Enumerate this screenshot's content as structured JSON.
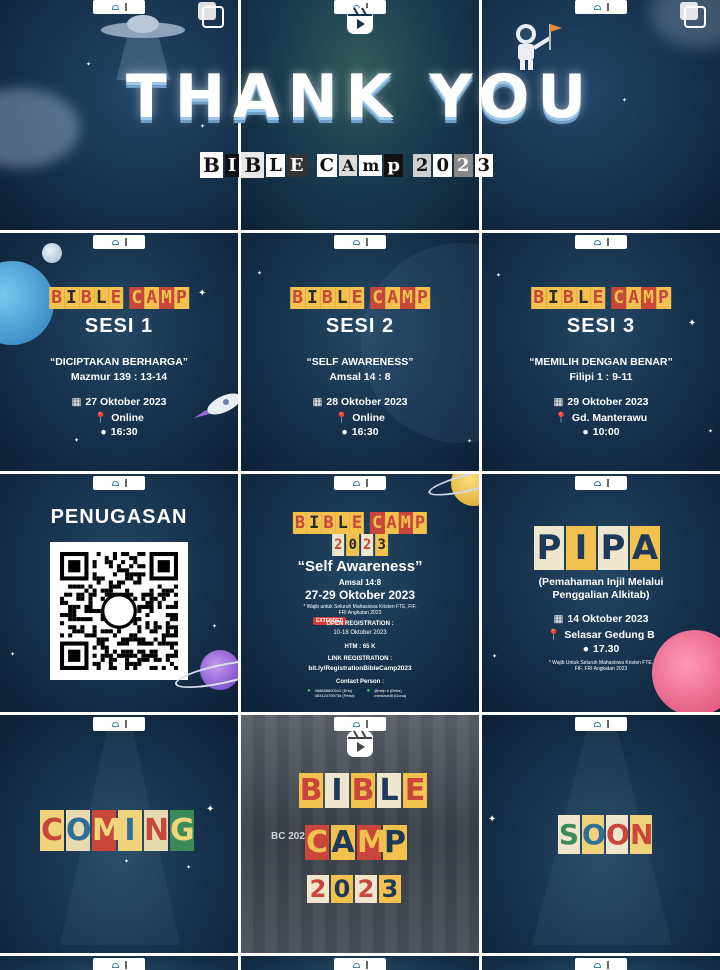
{
  "tile1": {
    "thank": "THANK YOU",
    "letters": [
      "B",
      "I",
      "B",
      "L",
      "E",
      " ",
      "C",
      "A",
      "m",
      "p",
      " ",
      "2",
      "0",
      "2",
      "3"
    ]
  },
  "sesi1": {
    "camp_a": [
      "B",
      "I",
      "B",
      "L",
      "E"
    ],
    "camp_b": [
      "C",
      "A",
      "M",
      "P"
    ],
    "sesi": "SESI 1",
    "theme": "“DICIPTAKAN BERHARGA”",
    "verse": "Mazmur 139 : 13-14",
    "date": "27 Oktober 2023",
    "place": "Online",
    "time": "16:30"
  },
  "sesi2": {
    "camp_a": [
      "B",
      "I",
      "B",
      "L",
      "E"
    ],
    "camp_b": [
      "C",
      "A",
      "M",
      "P"
    ],
    "sesi": "SESI 2",
    "theme": "“SELF AWARENESS”",
    "verse": "Amsal 14 : 8",
    "date": "28 Oktober 2023",
    "place": "Online",
    "time": "16:30"
  },
  "sesi3": {
    "camp_a": [
      "B",
      "I",
      "B",
      "L",
      "E"
    ],
    "camp_b": [
      "C",
      "A",
      "M",
      "P"
    ],
    "sesi": "SESI 3",
    "theme": "“MEMILIH DENGAN BENAR”",
    "verse": "Filipi 1 : 9-11",
    "date": "29 Oktober 2023",
    "place": "Gd. Manterawu",
    "time": "10:00"
  },
  "penugasan": {
    "title": "PENUGASAN"
  },
  "poster": {
    "camp_a": [
      "B",
      "I",
      "B",
      "L",
      "E"
    ],
    "camp_b": [
      "C",
      "A",
      "M",
      "P"
    ],
    "year": [
      "2",
      "0",
      "2",
      "3"
    ],
    "theme": "“Self Awareness”",
    "verse": "Amsal 14:8",
    "dates": "27-29 Oktober 2023",
    "audience": "* Wajib untuk Seluruh Mahasiswa Kristen FTE, FIF, FRI Angkatan 2023",
    "extended": "EXTENDED",
    "open_reg": "OPEN REGISTRATION :",
    "open_dates": "10-18 Oktober 2023",
    "htm": "HTM : 65 K",
    "link_label": "LINK REGISTRATION :",
    "link": "bit.ly/RegistrationBibleCamp2023",
    "contact_label": "Contact Person :",
    "contact_wa": "088888800012 (Erin) 083124709734 (Petra)",
    "contact_line": "@nkip.k (Britia) merdavid8 (Dona)"
  },
  "pipa": {
    "letters": [
      "P",
      "I",
      "P",
      "A"
    ],
    "subtitle": "(Pemahaman Injil Melalui Penggalian Alkitab)",
    "date": "14 Oktober 2023",
    "place": "Selasar Gedung B",
    "time": "17.30",
    "note": "* Wajib Untuk Seluruh Mahasiswa Kristen FTE, FIF, FRI Angkatan 2023"
  },
  "coming": {
    "letters": [
      "C",
      "O",
      "M",
      "I",
      "N",
      "G"
    ]
  },
  "photo": {
    "line1": [
      "B",
      "I",
      "B",
      "L",
      "E"
    ],
    "line2": [
      "C",
      "A",
      "M",
      "P"
    ],
    "line3": [
      "2",
      "0",
      "2",
      "3"
    ],
    "overlay": "BC 2022"
  },
  "soon": {
    "letters": [
      "S",
      "O",
      "O",
      "N"
    ]
  },
  "colors": {
    "bg": "#16304a",
    "yellow": "#f2c14e",
    "red": "#c8473a",
    "cream": "#efe6cf"
  }
}
